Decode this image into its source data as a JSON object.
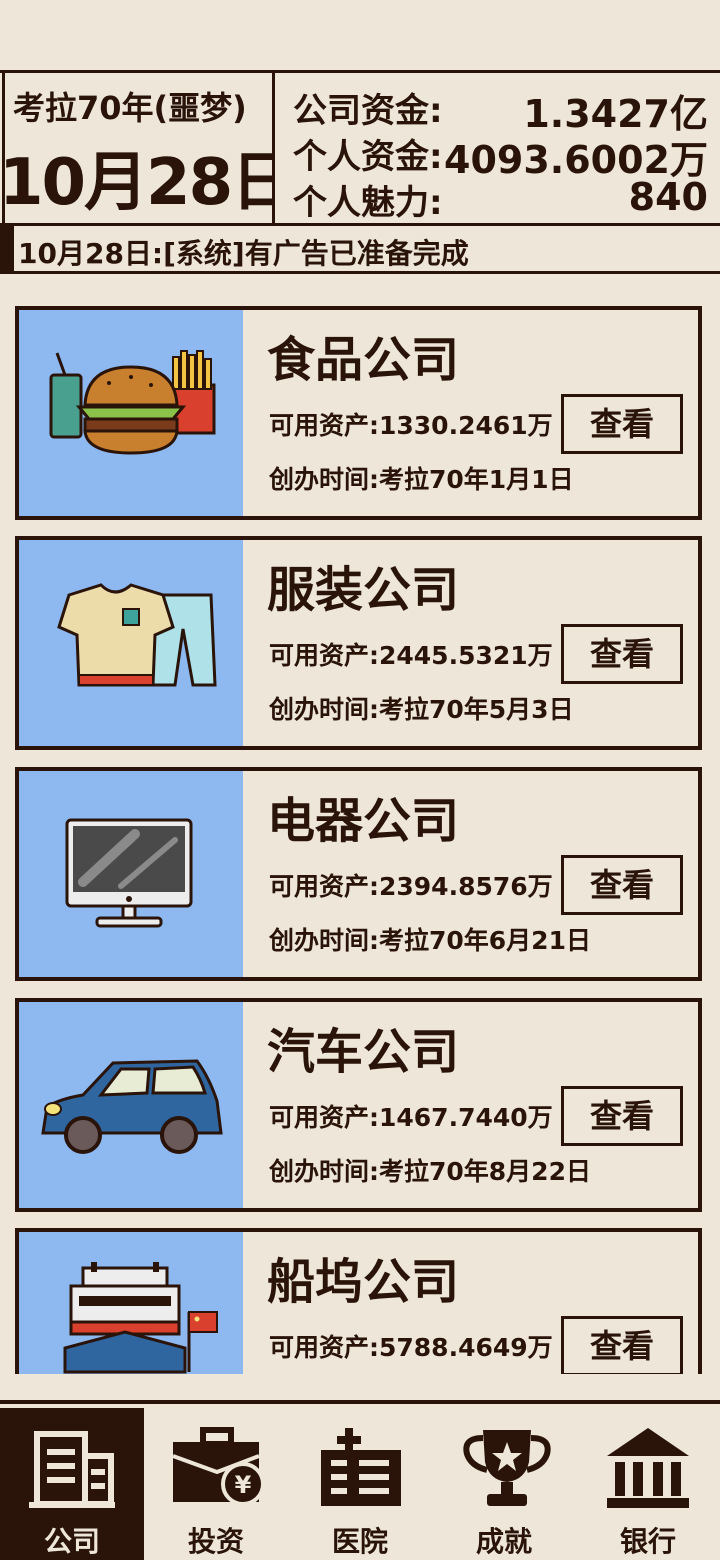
{
  "header": {
    "year_label": "考拉70年(噩梦)",
    "day_label": "10月28日",
    "company_funds_label": "公司资金:",
    "company_funds_value": "1.3427亿",
    "personal_funds_label": "个人资金:",
    "personal_funds_value": "4093.6002万",
    "charm_label": "个人魅力:",
    "charm_value": "840"
  },
  "notice": {
    "text": "10月28日:[系统]有广告已准备完成"
  },
  "companies": [
    {
      "name": "食品公司",
      "assets": "可用资产:1330.2461万",
      "founded": "创办时间:考拉70年1月1日",
      "button": "查看",
      "icon": "food-icon"
    },
    {
      "name": "服装公司",
      "assets": "可用资产:2445.5321万",
      "founded": "创办时间:考拉70年5月3日",
      "button": "查看",
      "icon": "clothing-icon"
    },
    {
      "name": "电器公司",
      "assets": "可用资产:2394.8576万",
      "founded": "创办时间:考拉70年6月21日",
      "button": "查看",
      "icon": "monitor-icon"
    },
    {
      "name": "汽车公司",
      "assets": "可用资产:1467.7440万",
      "founded": "创办时间:考拉70年8月22日",
      "button": "查看",
      "icon": "car-icon"
    },
    {
      "name": "船坞公司",
      "assets": "可用资产:5788.4649万",
      "founded": "",
      "button": "查看",
      "icon": "ship-icon"
    }
  ],
  "nav": [
    {
      "label": "公司",
      "icon": "building-icon",
      "active": true
    },
    {
      "label": "投资",
      "icon": "briefcase-yen-icon",
      "active": false
    },
    {
      "label": "医院",
      "icon": "hospital-icon",
      "active": false
    },
    {
      "label": "成就",
      "icon": "trophy-icon",
      "active": false
    },
    {
      "label": "银行",
      "icon": "bank-icon",
      "active": false
    }
  ],
  "colors": {
    "background": "#ede6d9",
    "ink": "#2a140a",
    "thumb": "#8db8f0"
  }
}
